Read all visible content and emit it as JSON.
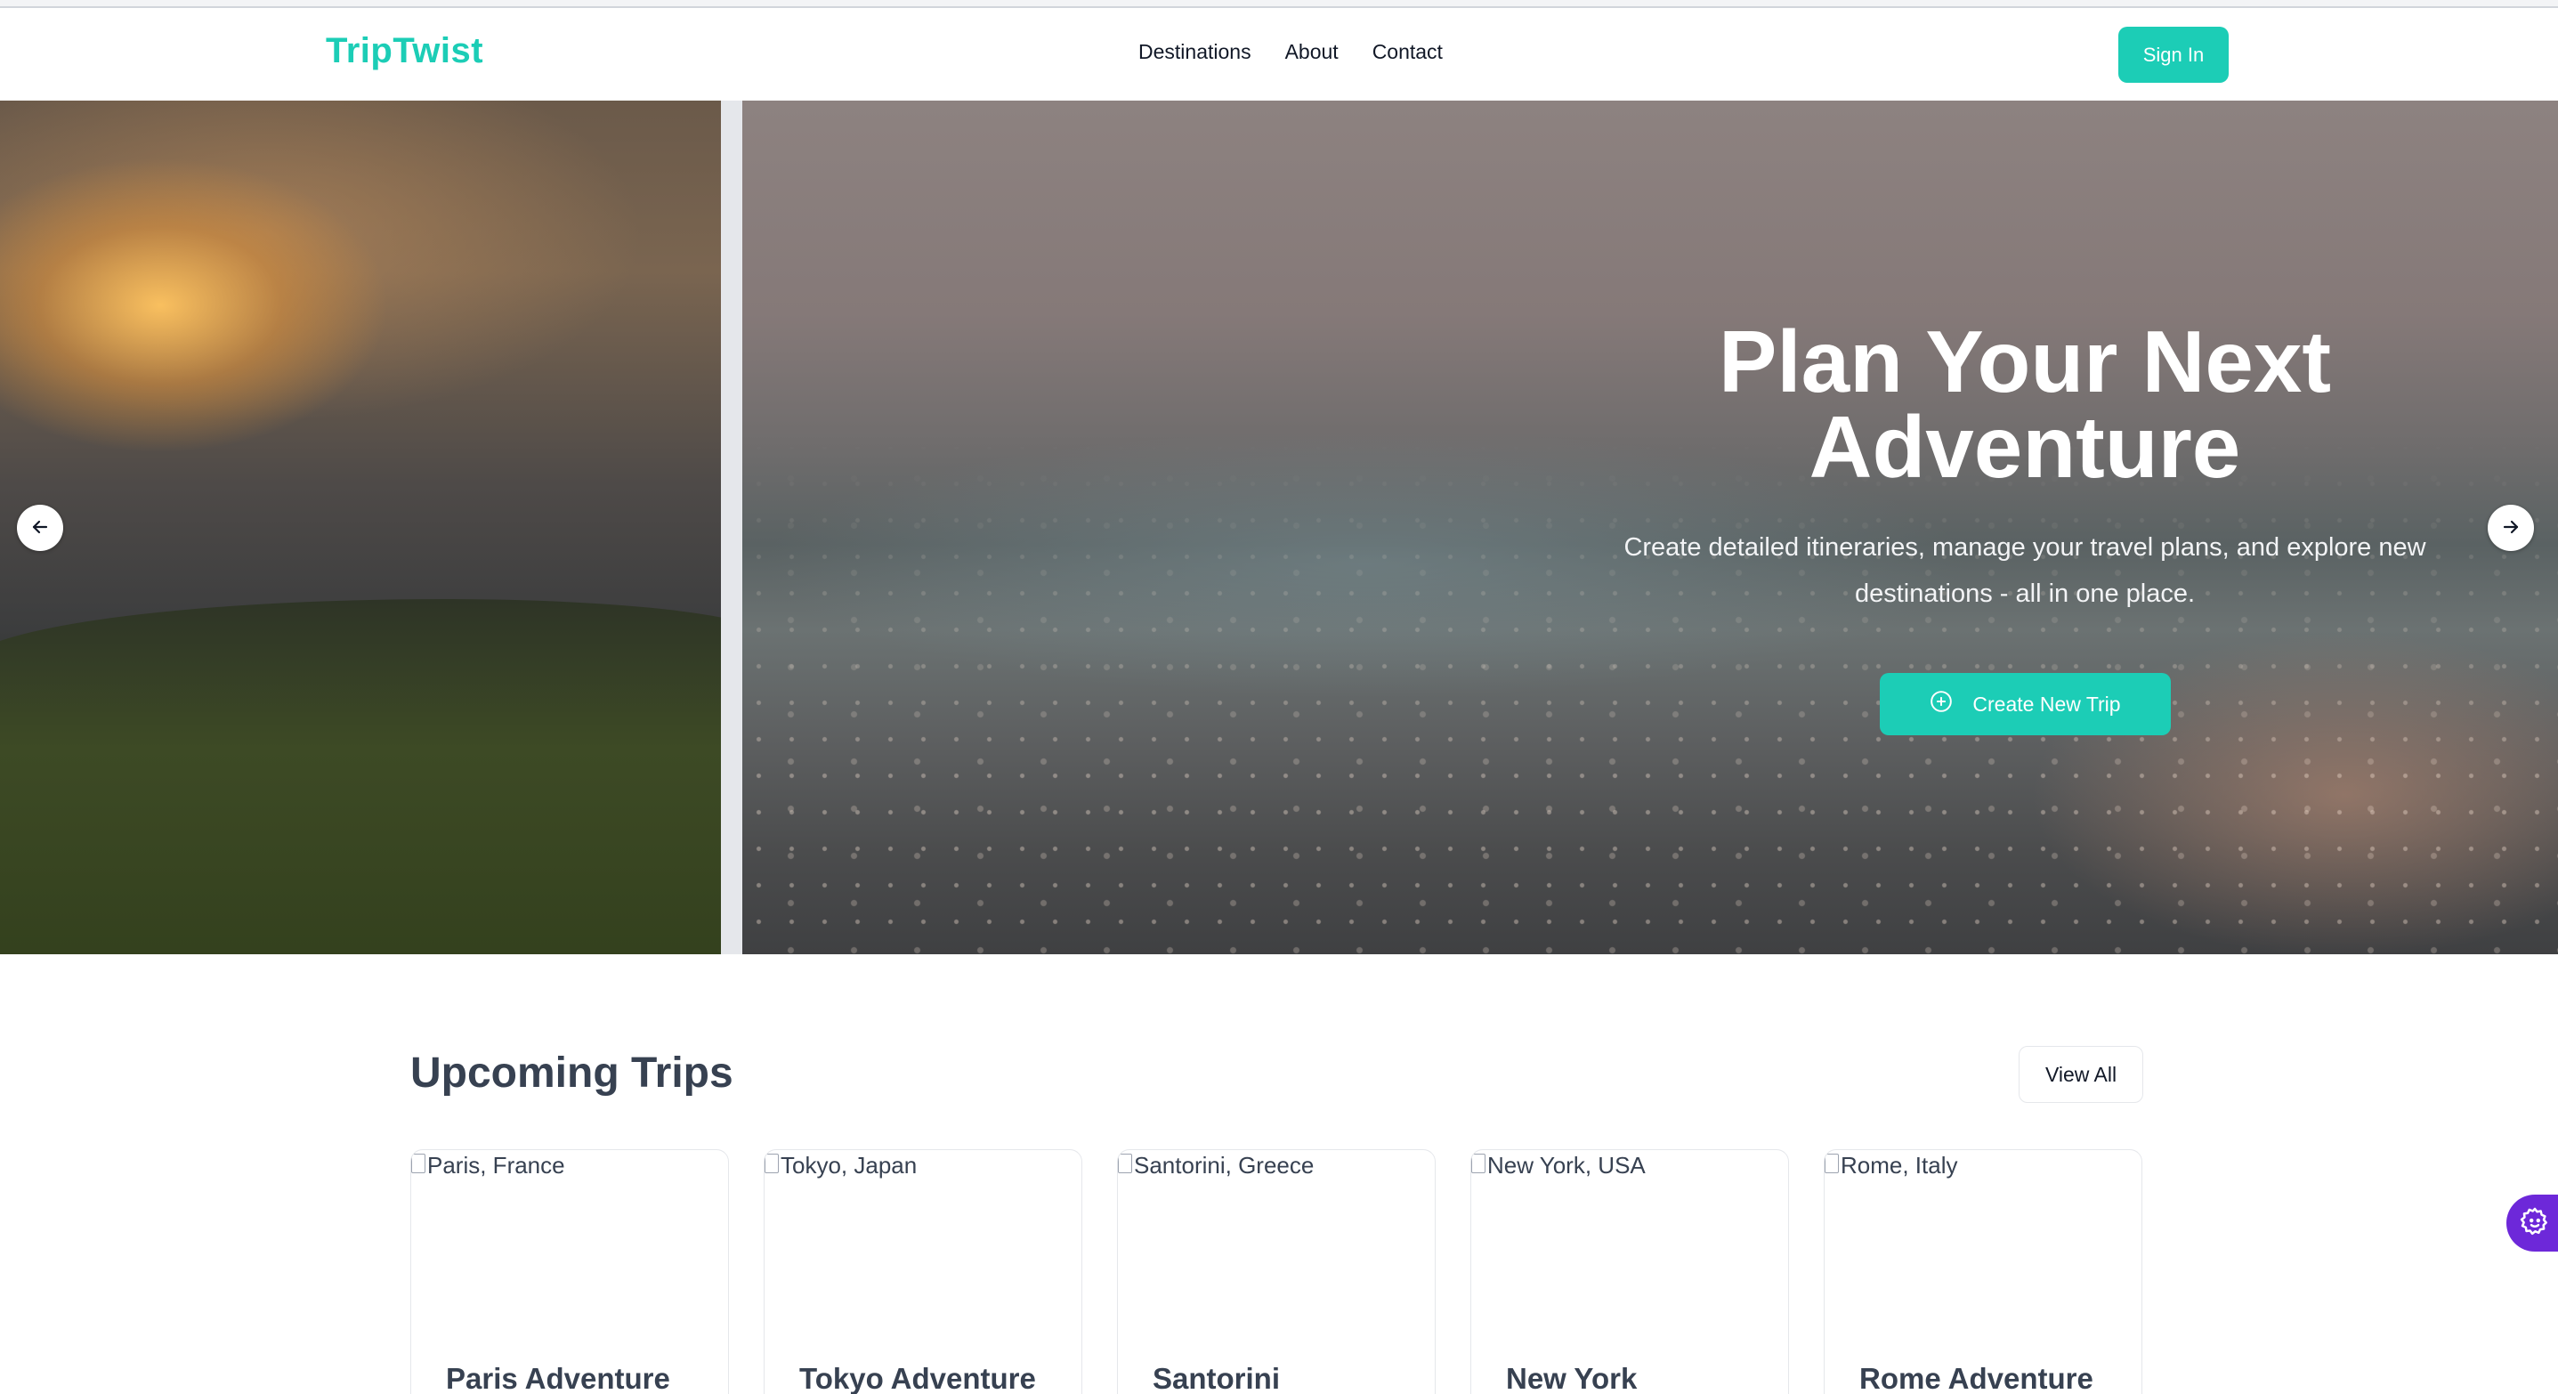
{
  "header": {
    "logo": "TripTwist",
    "nav": [
      "Destinations",
      "About",
      "Contact"
    ],
    "sign_in": "Sign In"
  },
  "hero": {
    "title": "Plan Your Next Adventure",
    "subtitle": "Create detailed itineraries, manage your travel plans, and explore new destinations - all in one place.",
    "cta": "Create New Trip",
    "icons": {
      "cta": "plus-circle-icon",
      "prev": "arrow-left-icon",
      "next": "arrow-right-icon"
    }
  },
  "trips": {
    "title": "Upcoming Trips",
    "view_all": "View All",
    "cards": [
      {
        "image_alt": "Paris, France",
        "title": "Paris Adventure"
      },
      {
        "image_alt": "Tokyo, Japan",
        "title": "Tokyo Adventure"
      },
      {
        "image_alt": "Santorini, Greece",
        "title": "Santorini"
      },
      {
        "image_alt": "New York, USA",
        "title": "New York"
      },
      {
        "image_alt": "Rome, Italy",
        "title": "Rome Adventure"
      }
    ]
  },
  "widget": {
    "icon": "gear-smile-icon"
  },
  "colors": {
    "accent": "#1ccdb6",
    "widget": "#6d28d9",
    "heading": "#374151"
  }
}
